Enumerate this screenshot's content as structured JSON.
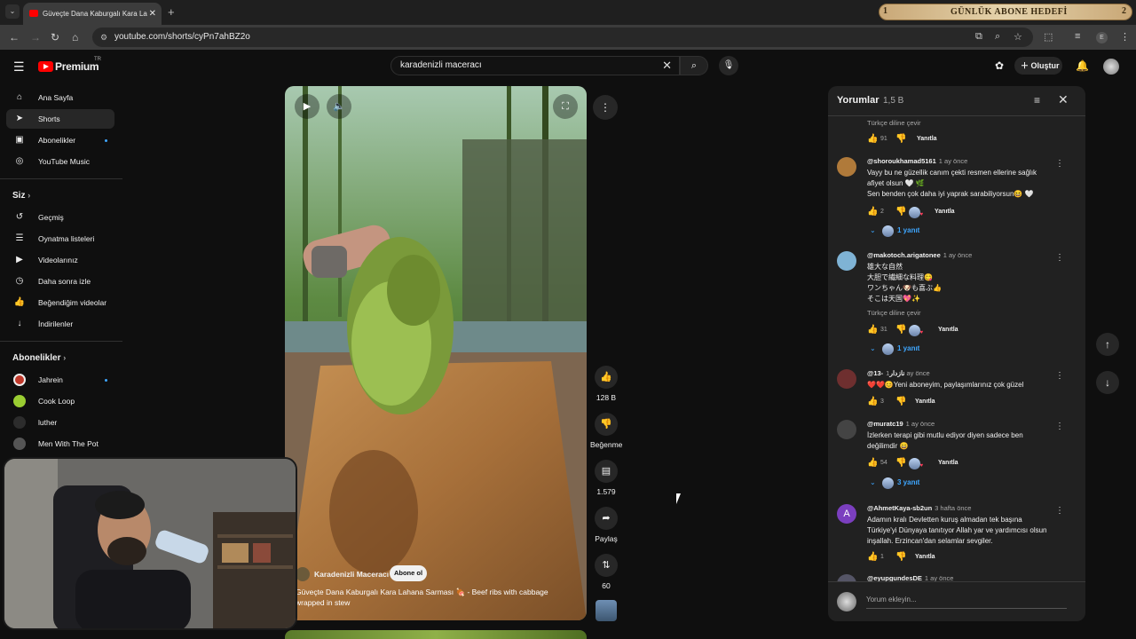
{
  "browser": {
    "tab_title": "Güveçte Dana Kaburgalı Kara La",
    "url_site_icon": "tune-icon",
    "url": "youtube.com/shorts/cyPn7ahBZ2o",
    "profile_initial": "E"
  },
  "stream_overlay": {
    "left_num": "1",
    "label": "GÜNLÜK ABONE HEDEFİ",
    "right_num": "2"
  },
  "header": {
    "logo_text": "Premium",
    "region": "TR",
    "search_value": "karadenizli maceracı",
    "create_label": "Oluştur"
  },
  "sidebar": {
    "main": [
      {
        "label": "Ana Sayfa",
        "icon": "home-icon"
      },
      {
        "label": "Shorts",
        "icon": "shorts-icon"
      },
      {
        "label": "Abonelikler",
        "icon": "subscriptions-icon"
      },
      {
        "label": "YouTube Music",
        "icon": "music-icon"
      }
    ],
    "you_heading": "Siz",
    "you": [
      {
        "label": "Geçmiş",
        "icon": "history-icon"
      },
      {
        "label": "Oynatma listeleri",
        "icon": "playlist-icon"
      },
      {
        "label": "Videolarınız",
        "icon": "video-icon"
      },
      {
        "label": "Daha sonra izle",
        "icon": "clock-icon"
      },
      {
        "label": "Beğendiğim videolar",
        "icon": "like-icon"
      },
      {
        "label": "İndirilenler",
        "icon": "download-icon"
      }
    ],
    "subs_heading": "Abonelikler",
    "subs": [
      {
        "label": "Jahrein",
        "color": "#c0392b"
      },
      {
        "label": "Cook Loop",
        "color": "#9acd32"
      },
      {
        "label": "luther",
        "color": "#2c2c2c"
      },
      {
        "label": "Men With The Pot",
        "color": "#555555"
      }
    ]
  },
  "short": {
    "channel": "Karadenizli Maceracı",
    "subscribe_label": "Abone ol",
    "title": "Güveçte Dana Kaburgalı Kara Lahana Sarması 🍖 - Beef ribs with cabbage wrapped in stew",
    "likes": "128 B",
    "dislike_label": "Beğenme",
    "comments_count": "1.579",
    "share_label": "Paylaş",
    "remix_count": "60"
  },
  "comments": {
    "title": "Yorumlar",
    "count": "1,5 B",
    "top_translate": "Türkçe diline çevir",
    "top_likes": "91",
    "reply_label": "Yanıtla",
    "items": [
      {
        "user": "@shoroukhamad5161",
        "time": "1 ay önce",
        "text": "Vayy bu ne güzellik canım çekti resmen ellerine sağlık afiyet olsun 🤍 🌿\nSen benden çok daha iyi yaprak sarabiliyorsun😆 🤍",
        "likes": "2",
        "replies": "1 yanıt",
        "avatar_color": "#b07a3a"
      },
      {
        "user": "@makotoch.arigatonee",
        "time": "1 ay önce",
        "text": "雄大な自然\n大胆で繊細な料理😋\nワンちゃん🐶も喜ぶ👍\nそこは天国💖✨",
        "translate": "Türkçe diline çevir",
        "likes": "31",
        "replies": "1 yanıt",
        "avatar_color": "#7fb3d5"
      },
      {
        "user": "@13-نازدار",
        "time": "1 ay önce",
        "text": "❤️❤️😊Yeni aboneyim, paylaşımlarınız çok güzel",
        "likes": "3",
        "avatar_color": "#6e2f2f"
      },
      {
        "user": "@muratc19",
        "time": "1 ay önce",
        "text": "İzlerken terapi gibi mutlu ediyor diyen sadece ben değilimdir 😄",
        "likes": "54",
        "replies": "3 yanıt",
        "avatar_color": "#444444"
      },
      {
        "user": "@AhmetKaya-sb2un",
        "time": "3 hafta önce",
        "text": "Adamın kralı Devletten kuruş  almadan tek başına Türkiye'yi  Dünyaya  tanıtıyor  Allah yar ve yardımcısı olsun inşallah. Erzincan'dan selamlar sevgiler.",
        "likes": "1",
        "avatar_letter": "A",
        "avatar_color": "#7b3fbf"
      },
      {
        "user": "@eyupgundesDE",
        "time": "1 ay önce"
      }
    ],
    "add_placeholder": "Yorum ekleyin..."
  }
}
